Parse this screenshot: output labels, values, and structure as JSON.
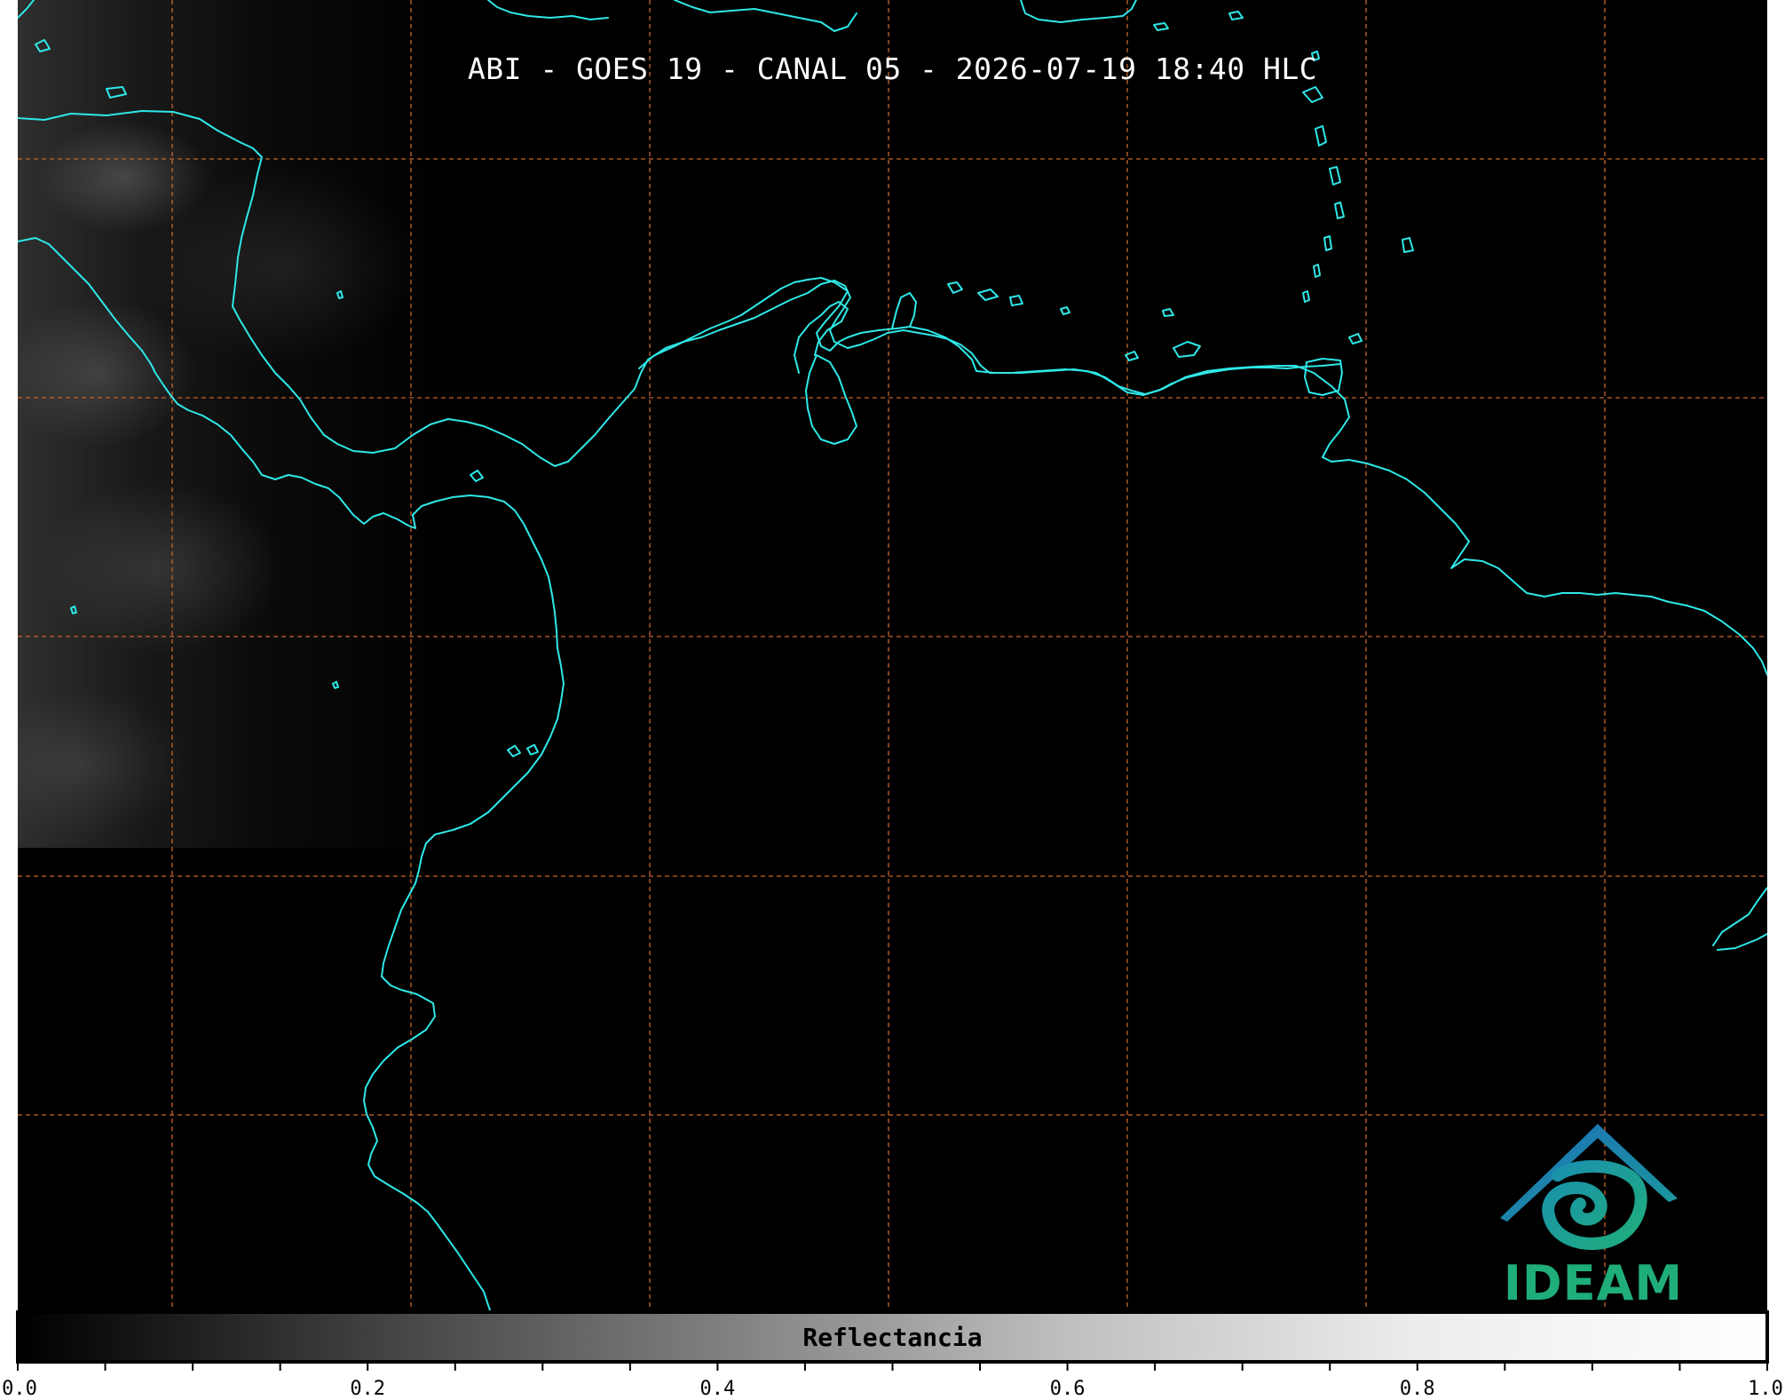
{
  "title": "ABI - GOES 19 - CANAL 05 - 2026-07-19 18:40 HLC",
  "logo": {
    "text": "IDEAM",
    "colors": {
      "roof": "#1d6fb8",
      "swirl": "#1a9a9a",
      "text": "#1fae7a"
    }
  },
  "colorbar": {
    "label": "Reflectancia",
    "range": [
      0.0,
      1.0
    ],
    "colormap": "grayscale",
    "major_ticks": [
      "0.0",
      "0.2",
      "0.4",
      "0.6",
      "0.8",
      "1.0"
    ],
    "minor_tick_step": 0.05
  },
  "colors": {
    "background": "#000000",
    "coastline": "#2fe8e8",
    "graticule": "#c8642a"
  }
}
